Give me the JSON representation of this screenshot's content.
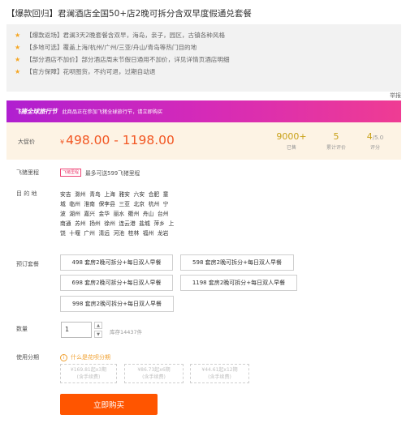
{
  "title": "【爆款回归】君澜酒店全国50+店2晚可拆分含双早度假通兑套餐",
  "features": [
    "【爆款返场】君澜3天2晚套餐含双早，海岛，亲子，园区，古镇各种风格",
    "【多地可选】覆盖上海/杭州/广州/三亚/舟山/青岛等热门目的地",
    "【部分酒店不加价】部分酒店周末节假日通用不加价，详见详情页酒店明细",
    "【官方保障】花呗图货，不约可退，过期自动退"
  ],
  "report_link": "举报",
  "banner": {
    "brand": "飞猪全球旅行节",
    "message": "此商品正在参加飞猪全球旅行节，请立即购买"
  },
  "price": {
    "label": "大促价",
    "currency": "¥",
    "range": "498.00 - 1198.00"
  },
  "stats": {
    "sold_value": "9000+",
    "sold_label": "已售",
    "reviews_value": "5",
    "reviews_label": "累计评价",
    "score_value": "4",
    "score_max": "/5.0",
    "score_label": "评分"
  },
  "feizhu_points": {
    "label": "飞猪里程",
    "tag": "飞猪里程",
    "text": "最多可送599飞猪里程"
  },
  "destination": {
    "label": "目 的 地",
    "rows": [
      [
        "安吉",
        "滁州",
        "青岛",
        "上海",
        "雅安",
        "六安",
        "合肥",
        "童"
      ],
      [
        "城",
        "临州",
        "淮南",
        "保李县",
        "三亚",
        "北京",
        "杭州",
        "宁"
      ],
      [
        "波",
        "湖州",
        "嘉兴",
        "金华",
        "丽水",
        "衢州",
        "舟山",
        "台州"
      ],
      [
        "南通",
        "苏州",
        "扬州",
        "徐州",
        "连云港",
        "盐城",
        "萍乡",
        "上"
      ],
      [
        "饶",
        "十堰",
        "广州",
        "清远",
        "河池",
        "桂林",
        "福州",
        "龙岩"
      ]
    ]
  },
  "packages": {
    "label": "预订套餐",
    "options": [
      "498 套房2晚可拆分+每日双人早餐",
      "598 套房2晚可拆分+每日双人早餐",
      "698 套房2晚可拆分+每日双人早餐",
      "1198 套房2晚可拆分+每日双人早餐",
      "998 套房2晚可拆分+每日双人早餐"
    ]
  },
  "quantity": {
    "label": "数量",
    "value": "1",
    "stock": "库存14437件"
  },
  "installments": {
    "label": "使用分期",
    "help": "什么是花呗分期",
    "options": [
      {
        "line1": "¥169.81起x3期",
        "line2": "(含手续费)"
      },
      {
        "line1": "¥86.73起x6期",
        "line2": "(含手续费)"
      },
      {
        "line1": "¥44.61起x12期",
        "line2": "(含手续费)"
      }
    ]
  },
  "buy_button": "立即购买",
  "colors": {
    "accent": "#ff5500",
    "price": "#f25622",
    "stats": "#c8a016",
    "banner_start": "#b01fd0",
    "banner_end": "#ef3c93"
  },
  "icons": {
    "feature": "star-icon",
    "help": "info-icon",
    "qty_up": "chevron-up-icon",
    "qty_down": "chevron-down-icon"
  }
}
